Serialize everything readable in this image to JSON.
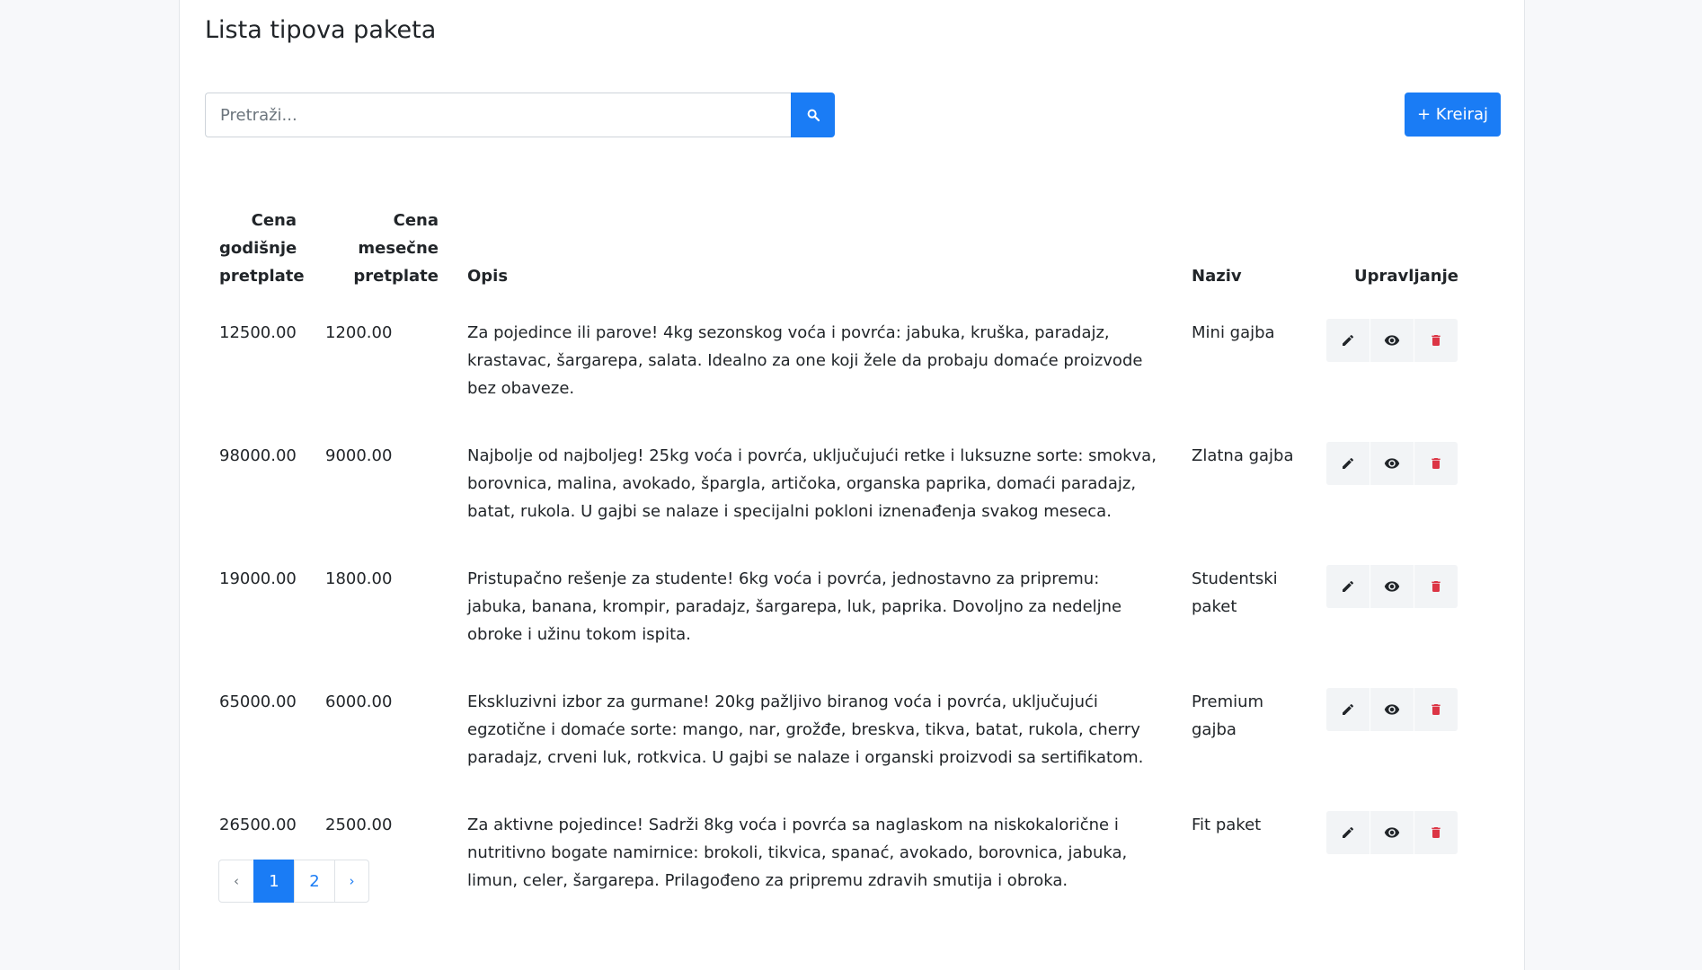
{
  "page": {
    "title": "Lista tipova paketa"
  },
  "search": {
    "placeholder": "Pretraži...",
    "value": ""
  },
  "toolbar": {
    "create_label": "+ Kreiraj"
  },
  "colors": {
    "primary": "#1a7cf5",
    "danger": "#dc3545",
    "icon_dark": "#212529",
    "action_bg": "#f2f4f6"
  },
  "table": {
    "headers": {
      "yearly_price": "Cena godišnje pretplate",
      "monthly_price": "Cena mesečne pretplate",
      "description": "Opis",
      "name": "Naziv",
      "actions": "Upravljanje"
    },
    "rows": [
      {
        "yearly_price": "12500.00",
        "monthly_price": "1200.00",
        "description": "Za pojedince ili parove! 4kg sezonskog voća i povrća: jabuka, kruška, paradajz, krastavac, šargarepa, salata. Idealno za one koji žele da probaju domaće proizvode bez obaveze.",
        "name": "Mini gajba"
      },
      {
        "yearly_price": "98000.00",
        "monthly_price": "9000.00",
        "description": "Najbolje od najboljeg! 25kg voća i povrća, uključujući retke i luksuzne sorte: smokva, borovnica, malina, avokado, špargla, artičoka, organska paprika, domaći paradajz, batat, rukola. U gajbi se nalaze i specijalni pokloni iznenađenja svakog meseca.",
        "name": "Zlatna gajba"
      },
      {
        "yearly_price": "19000.00",
        "monthly_price": "1800.00",
        "description": "Pristupačno rešenje za studente! 6kg voća i povrća, jednostavno za pripremu: jabuka, banana, krompir, paradajz, šargarepa, luk, paprika. Dovoljno za nedeljne obroke i užinu tokom ispita.",
        "name": "Studentski paket"
      },
      {
        "yearly_price": "65000.00",
        "monthly_price": "6000.00",
        "description": "Ekskluzivni izbor za gurmane! 20kg pažljivo biranog voća i povrća, uključujući egzotične i domaće sorte: mango, nar, grožđe, breskva, tikva, batat, rukola, cherry paradajz, crveni luk, rotkvica. U gajbi se nalaze i organski proizvodi sa sertifikatom.",
        "name": "Premium gajba"
      },
      {
        "yearly_price": "26500.00",
        "monthly_price": "2500.00",
        "description": "Za aktivne pojedince! Sadrži 8kg voća i povrća sa naglaskom na niskokalorične i nutritivno bogate namirnice: brokoli, tikvica, spanać, avokado, borovnica, jabuka, limun, celer, šargarepa. Prilagođeno za pripremu zdravih smutija i obroka.",
        "name": "Fit paket"
      }
    ],
    "action_icons": [
      "pencil-icon",
      "eye-icon",
      "trash-icon"
    ]
  },
  "pagination": {
    "prev_label": "‹",
    "next_label": "›",
    "pages": [
      "1",
      "2"
    ],
    "current": "1"
  }
}
